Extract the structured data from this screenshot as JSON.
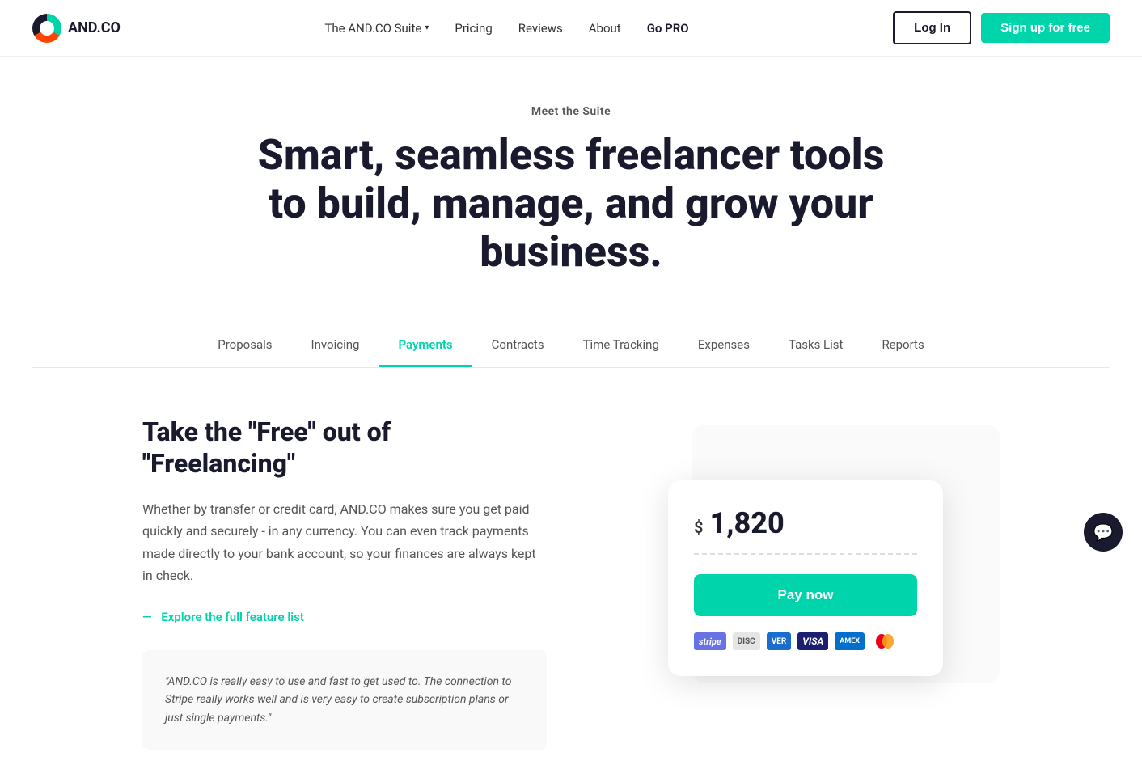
{
  "logo": {
    "text": "AND.CO"
  },
  "nav": {
    "suite_label": "The AND.CO Suite",
    "pricing_label": "Pricing",
    "reviews_label": "Reviews",
    "about_label": "About",
    "gopro_label": "Go PRO",
    "login_label": "Log In",
    "signup_label": "Sign up for free"
  },
  "hero": {
    "eyebrow": "Meet the Suite",
    "title": "Smart, seamless freelancer tools to build, manage, and grow your business."
  },
  "tabs": [
    {
      "id": "proposals",
      "label": "Proposals",
      "active": false
    },
    {
      "id": "invoicing",
      "label": "Invoicing",
      "active": false
    },
    {
      "id": "payments",
      "label": "Payments",
      "active": true
    },
    {
      "id": "contracts",
      "label": "Contracts",
      "active": false
    },
    {
      "id": "time-tracking",
      "label": "Time Tracking",
      "active": false
    },
    {
      "id": "expenses",
      "label": "Expenses",
      "active": false
    },
    {
      "id": "tasks-list",
      "label": "Tasks List",
      "active": false
    },
    {
      "id": "reports",
      "label": "Reports",
      "active": false
    }
  ],
  "content": {
    "title": "Take the \"Free\" out of \"Freelancing\"",
    "body": "Whether by transfer or credit card, AND.CO makes sure you get paid quickly and securely - in any currency. You can even track payments made directly to your bank account, so your finances are always kept in check.",
    "explore_label": "Explore the full feature list",
    "explore_prefix": "—"
  },
  "testimonial": {
    "text": "\"AND.CO is really easy to use and fast to get used to. The connection to Stripe really works well and is very easy to create subscription plans or just single payments.\""
  },
  "payment_card": {
    "currency": "$",
    "amount": "1,820",
    "pay_button": "Pay now",
    "logos": [
      "stripe",
      "disc",
      "ver",
      "visa",
      "amex",
      "mc"
    ]
  }
}
